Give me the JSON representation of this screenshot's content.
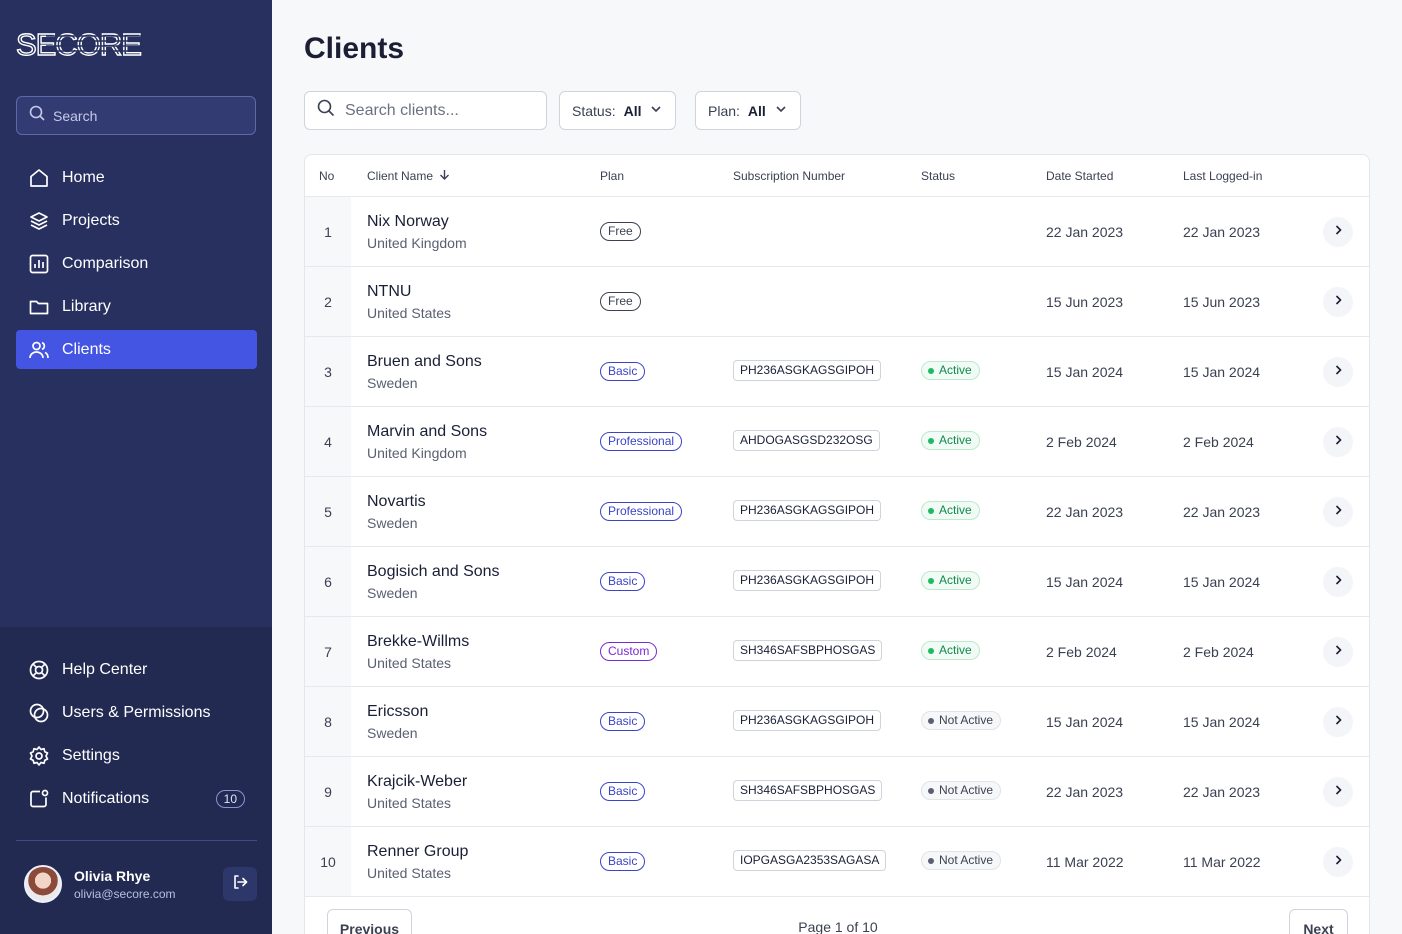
{
  "brand": {
    "logo_text": "SECORE"
  },
  "sidebar": {
    "search_placeholder": "Search",
    "nav": [
      {
        "label": "Home",
        "icon": "home-icon"
      },
      {
        "label": "Projects",
        "icon": "layers-icon"
      },
      {
        "label": "Comparison",
        "icon": "bar-chart-icon"
      },
      {
        "label": "Library",
        "icon": "folder-icon"
      },
      {
        "label": "Clients",
        "icon": "users-icon",
        "active": true
      }
    ],
    "bottom_nav": [
      {
        "label": "Help Center",
        "icon": "lifebuoy-icon"
      },
      {
        "label": "Users & Permissions",
        "icon": "permissions-icon"
      },
      {
        "label": "Settings",
        "icon": "gear-icon"
      },
      {
        "label": "Notifications",
        "icon": "notification-icon",
        "count": "10"
      }
    ],
    "user": {
      "name": "Olivia Rhye",
      "email": "olivia@secore.com"
    }
  },
  "main": {
    "title": "Clients",
    "search_placeholder": "Search clients...",
    "filters": {
      "status_label": "Status:",
      "status_value": "All",
      "plan_label": "Plan:",
      "plan_value": "All"
    },
    "columns": {
      "no": "No",
      "name": "Client Name",
      "plan": "Plan",
      "subscription": "Subscription Number",
      "status": "Status",
      "date_started": "Date Started",
      "last_logged": "Last Logged-in"
    },
    "rows": [
      {
        "no": "1",
        "name": "Nix Norway",
        "country": "United Kingdom",
        "plan": "Free",
        "subscription": "",
        "status": "",
        "date_started": "22 Jan 2023",
        "last_logged": "22 Jan 2023"
      },
      {
        "no": "2",
        "name": "NTNU",
        "country": "United States",
        "plan": "Free",
        "subscription": "",
        "status": "",
        "date_started": "15 Jun 2023",
        "last_logged": "15 Jun 2023"
      },
      {
        "no": "3",
        "name": "Bruen and Sons",
        "country": "Sweden",
        "plan": "Basic",
        "subscription": "PH236ASGKAGSGIPOH",
        "status": "Active",
        "date_started": "15 Jan 2024",
        "last_logged": "15 Jan 2024"
      },
      {
        "no": "4",
        "name": "Marvin and Sons",
        "country": "United Kingdom",
        "plan": "Professional",
        "subscription": "AHDOGASGSD232OSG",
        "status": "Active",
        "date_started": "2 Feb 2024",
        "last_logged": "2 Feb 2024"
      },
      {
        "no": "5",
        "name": "Novartis",
        "country": "Sweden",
        "plan": "Professional",
        "subscription": "PH236ASGKAGSGIPOH",
        "status": "Active",
        "date_started": "22 Jan 2023",
        "last_logged": "22 Jan 2023"
      },
      {
        "no": "6",
        "name": "Bogisich and Sons",
        "country": "Sweden",
        "plan": "Basic",
        "subscription": "PH236ASGKAGSGIPOH",
        "status": "Active",
        "date_started": "15 Jan 2024",
        "last_logged": "15 Jan 2024"
      },
      {
        "no": "7",
        "name": "Brekke-Willms",
        "country": "United States",
        "plan": "Custom",
        "subscription": "SH346SAFSBPHOSGAS",
        "status": "Active",
        "date_started": "2 Feb 2024",
        "last_logged": "2 Feb 2024"
      },
      {
        "no": "8",
        "name": "Ericsson",
        "country": "Sweden",
        "plan": "Basic",
        "subscription": "PH236ASGKAGSGIPOH",
        "status": "Not Active",
        "date_started": "15 Jan 2024",
        "last_logged": "15 Jan 2024"
      },
      {
        "no": "9",
        "name": "Krajcik-Weber",
        "country": "United States",
        "plan": "Basic",
        "subscription": "SH346SAFSBPHOSGAS",
        "status": "Not Active",
        "date_started": "22 Jan 2023",
        "last_logged": "22 Jan 2023"
      },
      {
        "no": "10",
        "name": "Renner Group",
        "country": "United States",
        "plan": "Basic",
        "subscription": "IOPGASGA2353SAGASA",
        "status": "Not Active",
        "date_started": "11 Mar 2022",
        "last_logged": "11 Mar 2022"
      }
    ],
    "pagination": {
      "previous": "Previous",
      "info": "Page 1 of 10",
      "next": "Next"
    }
  },
  "colors": {
    "sidebar_bg": "#27305f",
    "active_nav": "#4455e3",
    "plan_basic": "#3b43c9",
    "plan_custom": "#7b2ad3",
    "status_active": "#12894b"
  }
}
